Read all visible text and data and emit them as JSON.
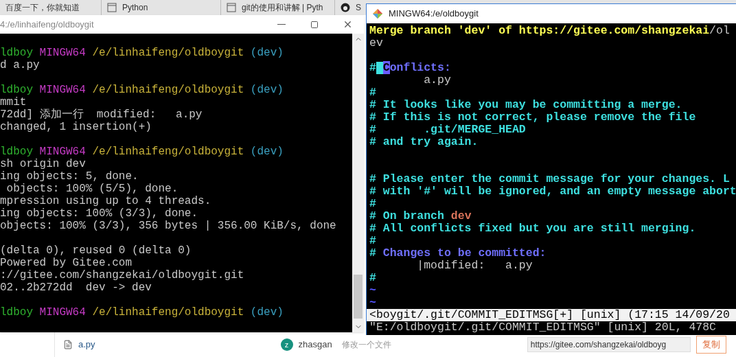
{
  "browser_tabs": [
    {
      "label": "百度一下，你就知道",
      "kind": "plain"
    },
    {
      "label": "Python",
      "kind": "page"
    },
    {
      "label": "git的使用和讲解 | Pyth",
      "kind": "page"
    },
    {
      "label": "S",
      "kind": "github"
    }
  ],
  "left_window": {
    "title": "4:/e/linhaifeng/oldboygit",
    "lines": [
      {
        "kind": "text",
        "spans": [
          {
            "text": "ldboy ",
            "kind": "user"
          },
          {
            "text": "MINGW64 ",
            "kind": "host"
          },
          {
            "text": "/e/linhaifeng/oldboygit ",
            "kind": "path"
          },
          {
            "text": "(dev)",
            "kind": "branch"
          }
        ]
      },
      {
        "kind": "text",
        "spans": [
          {
            "text": "d a.py",
            "kind": "plain"
          }
        ]
      },
      {
        "kind": "blank"
      },
      {
        "kind": "text",
        "spans": [
          {
            "text": "ldboy ",
            "kind": "user"
          },
          {
            "text": "MINGW64 ",
            "kind": "host"
          },
          {
            "text": "/e/linhaifeng/oldboygit ",
            "kind": "path"
          },
          {
            "text": "(dev)",
            "kind": "branch"
          }
        ]
      },
      {
        "kind": "text",
        "spans": [
          {
            "text": "mmit",
            "kind": "plain"
          }
        ]
      },
      {
        "kind": "text",
        "spans": [
          {
            "text": "72dd] 添加一行  modified:   a.py",
            "kind": "plain"
          }
        ]
      },
      {
        "kind": "text",
        "spans": [
          {
            "text": "changed, 1 insertion(+)",
            "kind": "plain"
          }
        ]
      },
      {
        "kind": "blank"
      },
      {
        "kind": "text",
        "spans": [
          {
            "text": "ldboy ",
            "kind": "user"
          },
          {
            "text": "MINGW64 ",
            "kind": "host"
          },
          {
            "text": "/e/linhaifeng/oldboygit ",
            "kind": "path"
          },
          {
            "text": "(dev)",
            "kind": "branch"
          }
        ]
      },
      {
        "kind": "text",
        "spans": [
          {
            "text": "sh origin dev",
            "kind": "plain"
          }
        ]
      },
      {
        "kind": "text",
        "spans": [
          {
            "text": "ing objects: 5, done.",
            "kind": "plain"
          }
        ]
      },
      {
        "kind": "text",
        "spans": [
          {
            "text": " objects: 100% (5/5), done.",
            "kind": "plain"
          }
        ]
      },
      {
        "kind": "text",
        "spans": [
          {
            "text": "mpression using up to 4 threads.",
            "kind": "plain"
          }
        ]
      },
      {
        "kind": "text",
        "spans": [
          {
            "text": "ing objects: 100% (3/3), done.",
            "kind": "plain"
          }
        ]
      },
      {
        "kind": "text",
        "spans": [
          {
            "text": "objects: 100% (3/3), 356 bytes | 356.00 KiB/s, done",
            "kind": "plain"
          }
        ]
      },
      {
        "kind": "blank"
      },
      {
        "kind": "text",
        "spans": [
          {
            "text": "(delta 0), reused 0 (delta 0)",
            "kind": "plain"
          }
        ]
      },
      {
        "kind": "text",
        "spans": [
          {
            "text": "Powered by Gitee.com",
            "kind": "plain"
          }
        ]
      },
      {
        "kind": "text",
        "spans": [
          {
            "text": "://gitee.com/shangzekai/oldboygit.git",
            "kind": "plain"
          }
        ]
      },
      {
        "kind": "text",
        "spans": [
          {
            "text": "02..2b272dd  dev -> dev",
            "kind": "plain"
          }
        ]
      },
      {
        "kind": "blank"
      },
      {
        "kind": "text",
        "spans": [
          {
            "text": "ldboy ",
            "kind": "user"
          },
          {
            "text": "MINGW64 ",
            "kind": "host"
          },
          {
            "text": "/e/linhaifeng/oldboygit ",
            "kind": "path"
          },
          {
            "text": "(dev)",
            "kind": "branch"
          }
        ]
      }
    ]
  },
  "right_window": {
    "title": "MINGW64:/e/oldboygit",
    "lines": [
      {
        "kind": "text",
        "spans": [
          {
            "text": "Merge branch 'dev' of https://gitee.com/shangzekai",
            "kind": "title"
          },
          {
            "text": "/ol",
            "kind": "plain"
          }
        ]
      },
      {
        "kind": "text",
        "spans": [
          {
            "text": "ev",
            "kind": "plain"
          }
        ]
      },
      {
        "kind": "blank"
      },
      {
        "kind": "text",
        "spans": [
          {
            "text": "#",
            "kind": "comment"
          },
          {
            "kind": "cursor"
          },
          {
            "text": "C",
            "kind": "match"
          },
          {
            "text": "onflicts:",
            "kind": "heading"
          }
        ]
      },
      {
        "kind": "text",
        "spans": [
          {
            "text": "        a.py",
            "kind": "plain"
          }
        ]
      },
      {
        "kind": "text",
        "spans": [
          {
            "text": "#",
            "kind": "comment"
          }
        ]
      },
      {
        "kind": "text",
        "spans": [
          {
            "text": "# It looks like you may be committing a merge.",
            "kind": "comment"
          }
        ]
      },
      {
        "kind": "text",
        "spans": [
          {
            "text": "# If this is not correct, please remove the file",
            "kind": "comment"
          }
        ]
      },
      {
        "kind": "text",
        "spans": [
          {
            "text": "#       .git/MERGE_HEAD",
            "kind": "comment"
          }
        ]
      },
      {
        "kind": "text",
        "spans": [
          {
            "text": "# and try again.",
            "kind": "comment"
          }
        ]
      },
      {
        "kind": "blank"
      },
      {
        "kind": "blank"
      },
      {
        "kind": "text",
        "spans": [
          {
            "text": "# Please enter the commit message for your changes. L",
            "kind": "comment"
          }
        ]
      },
      {
        "kind": "text",
        "spans": [
          {
            "text": "# with '#' will be ignored, and an empty message abort",
            "kind": "comment"
          }
        ]
      },
      {
        "kind": "text",
        "spans": [
          {
            "text": "#",
            "kind": "comment"
          }
        ]
      },
      {
        "kind": "text",
        "spans": [
          {
            "text": "# On branch ",
            "kind": "comment"
          },
          {
            "text": "dev",
            "kind": "branch"
          }
        ]
      },
      {
        "kind": "text",
        "spans": [
          {
            "text": "# All conflicts fixed but you are still merging.",
            "kind": "comment"
          }
        ]
      },
      {
        "kind": "text",
        "spans": [
          {
            "text": "#",
            "kind": "comment"
          }
        ]
      },
      {
        "kind": "text",
        "spans": [
          {
            "text": "#",
            "kind": "comment"
          },
          {
            "text": " Changes to be committed:",
            "kind": "heading"
          }
        ]
      },
      {
        "kind": "text",
        "spans": [
          {
            "text": "       |modified:   a.py",
            "kind": "plain"
          }
        ]
      },
      {
        "kind": "text",
        "spans": [
          {
            "text": "#",
            "kind": "comment"
          }
        ]
      },
      {
        "kind": "text",
        "spans": [
          {
            "text": "~",
            "kind": "tilde"
          }
        ]
      },
      {
        "kind": "text",
        "spans": [
          {
            "text": "~",
            "kind": "tilde"
          }
        ]
      }
    ],
    "status_line": "<boygit/.git/COMMIT_EDITMSG[+] [unix] (17:15 14/09/20",
    "message_line": "\"E:/oldboygit/.git/COMMIT_EDITMSG\" [unix] 20L, 478C"
  },
  "page": {
    "file_name": "a.py",
    "avatar_letter": "z",
    "author": "zhasgan",
    "commit_message": "修改一个文件",
    "clone_url": "https://gitee.com/shangzekai/oldboyg",
    "copy_button": "复制"
  }
}
